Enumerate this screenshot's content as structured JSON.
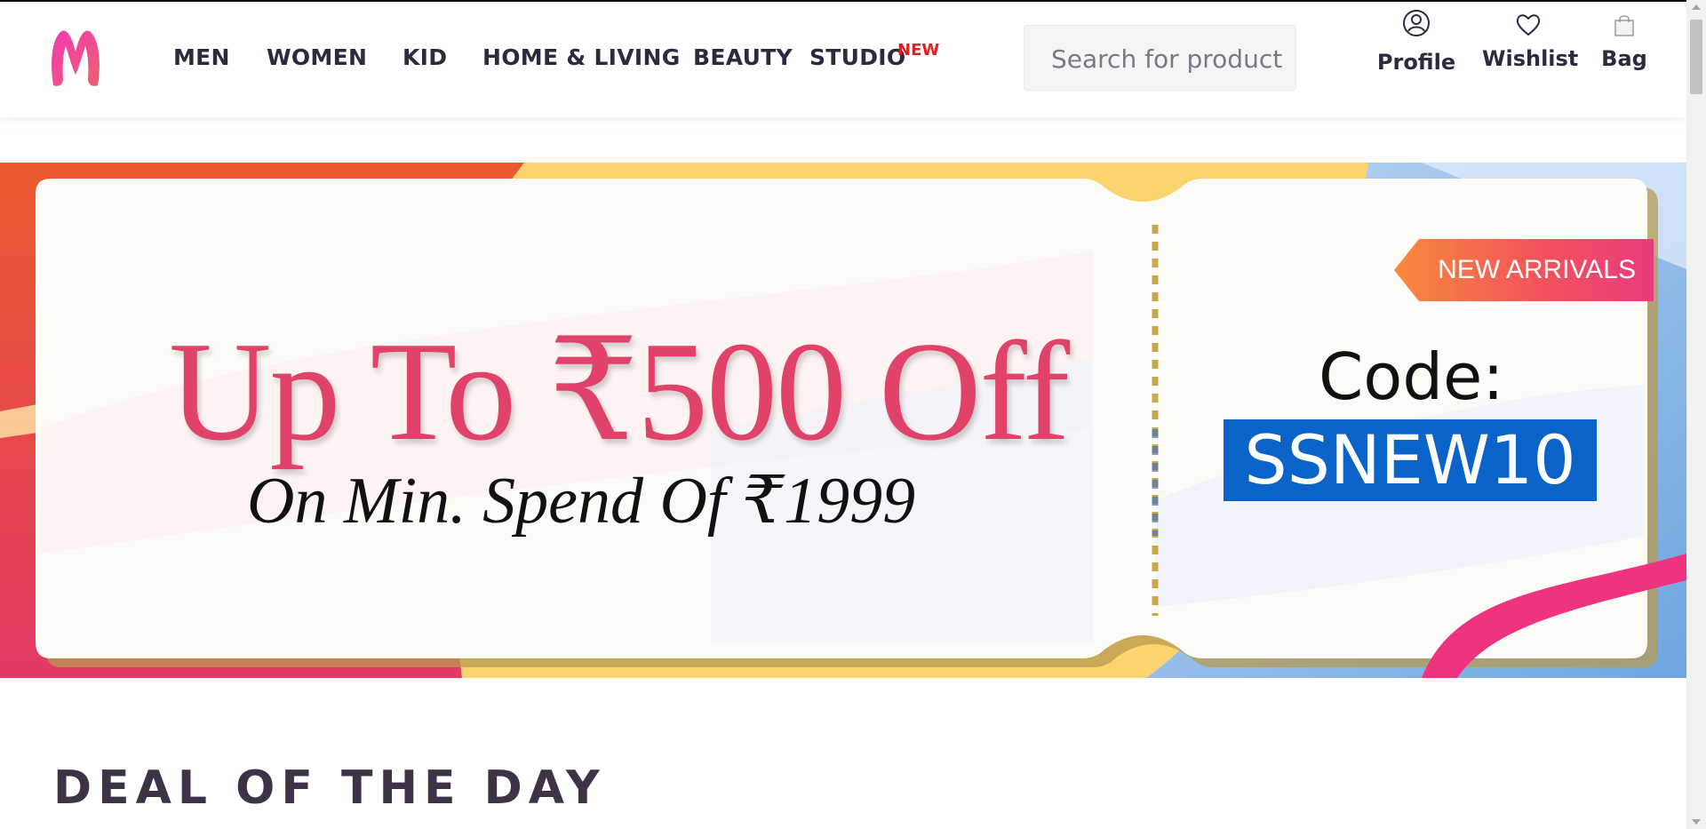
{
  "header": {
    "logo_text": "M",
    "nav": [
      {
        "label": "MEN"
      },
      {
        "label": "WOMEN"
      },
      {
        "label": "KID"
      },
      {
        "label": "HOME & LIVING"
      },
      {
        "label": "BEAUTY"
      },
      {
        "label": "STUDIO",
        "badge": "NEW"
      }
    ],
    "search": {
      "placeholder": "Search for product",
      "value": ""
    },
    "actions": [
      {
        "label": "Profile",
        "icon": "profile-icon"
      },
      {
        "label": "Wishlist",
        "icon": "heart-icon"
      },
      {
        "label": "Bag",
        "icon": "bag-icon"
      }
    ]
  },
  "banner": {
    "headline": "Up To ₹500 Off",
    "subline": "On Min. Spend Of ₹1999",
    "badge": "NEW ARRIVALS",
    "code_label": "Code:",
    "code": "SSNEW10"
  },
  "sections": {
    "deal_title": "DEAL OF THE DAY"
  },
  "colors": {
    "brand": "#e83e8c",
    "headline": "#e0426a",
    "code_bg": "#0a63c9",
    "new_badge": "#e41d1d"
  }
}
